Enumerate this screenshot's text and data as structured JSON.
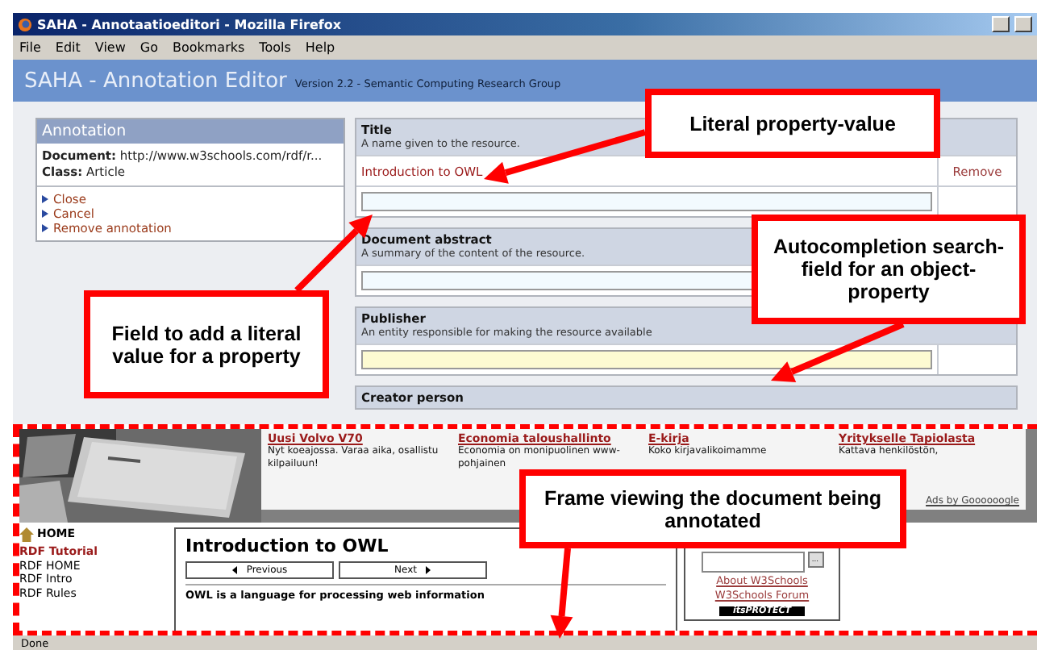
{
  "window": {
    "title": "SAHA - Annotaatioeditori - Mozilla Firefox"
  },
  "menu": [
    "File",
    "Edit",
    "View",
    "Go",
    "Bookmarks",
    "Tools",
    "Help"
  ],
  "header": {
    "title": "SAHA - Annotation Editor",
    "subtitle": "Version 2.2 - Semantic Computing Research Group"
  },
  "annotation": {
    "heading": "Annotation",
    "fields": [
      {
        "label": "Document:",
        "value": "http://www.w3schools.com/rdf/r..."
      },
      {
        "label": "Class:",
        "value": "Article"
      }
    ],
    "actions": [
      "Close",
      "Cancel",
      "Remove annotation"
    ]
  },
  "properties": [
    {
      "kind": "literal",
      "name": "Title",
      "description": "A name given to the resource.",
      "values": [
        {
          "text": "Introduction to OWL",
          "action": "Remove"
        }
      ]
    },
    {
      "kind": "literal",
      "name": "Document abstract",
      "description": "A summary of the content of the resource."
    },
    {
      "kind": "object",
      "name": "Publisher",
      "description": "An entity responsible for making the resource available"
    },
    {
      "kind": "collapsed",
      "name": "Creator person"
    }
  ],
  "frame": {
    "ads": [
      {
        "title": "Uusi Volvo V70",
        "text": "Nyt koeajossa. Varaa aika, osallistu kilpailuun!"
      },
      {
        "title": "Economia taloushallinto",
        "text": "Economia on monipuolinen www- pohjainen"
      },
      {
        "title": "E-kirja",
        "text": "Koko kirjavalikoimamme"
      },
      {
        "title": "Yritykselle Tapiolasta",
        "text": "Kattava henkilöstön,"
      }
    ],
    "ads_credit": "Ads by Goooooogle",
    "nav": {
      "home": "HOME",
      "section": "RDF Tutorial",
      "items": [
        "RDF HOME",
        "RDF Intro",
        "RDF Rules"
      ]
    },
    "page": {
      "heading": "Introduction to OWL",
      "previous": "Previous",
      "next": "Next",
      "intro": "OWL is a language for processing web information"
    },
    "side": {
      "search_button": "...",
      "links": [
        "About W3Schools",
        "W3Schools Forum"
      ],
      "badge": "itsPROTECT"
    }
  },
  "callouts": [
    "Literal property-value",
    "Autocompletion search-field for an object-property",
    "Field to add a literal value for a property",
    "Frame viewing the document being annotated"
  ],
  "status_bar": "Done"
}
